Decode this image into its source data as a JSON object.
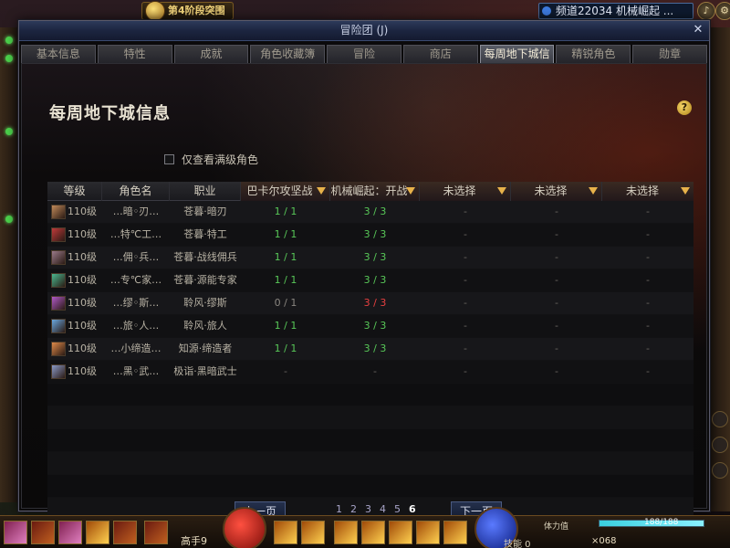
{
  "hud": {
    "stage_badge": "第4阶段突围",
    "channel": "频道22034 机械崛起 ..."
  },
  "window": {
    "title": "冒险团 (J)",
    "close_glyph": "✕",
    "tabs": [
      {
        "label": "基本信息",
        "active": false
      },
      {
        "label": "特性",
        "active": false
      },
      {
        "label": "成就",
        "active": false
      },
      {
        "label": "角色收藏簿",
        "active": false
      },
      {
        "label": "冒险",
        "active": false
      },
      {
        "label": "商店",
        "active": false
      },
      {
        "label": "每周地下城信息",
        "active": true
      },
      {
        "label": "精锐角色",
        "active": false
      },
      {
        "label": "勋章",
        "active": false
      }
    ],
    "heading": "每周地下城信息",
    "help_glyph": "?",
    "only_max_level_label": "仅查看满级角色"
  },
  "table": {
    "headers": {
      "level": "等级",
      "name": "角色名",
      "job": "职业",
      "d1": "巴卡尔攻坚战",
      "d2": "机械崛起：开战",
      "d3": "未选择",
      "d4": "未选择",
      "d5": "未选择"
    },
    "rows": [
      {
        "level": "110级",
        "name": "…暗◦刃…",
        "job": "苍暮·暗刃",
        "d1": "1 / 1",
        "d1_status": "green",
        "d2": "3 / 3",
        "d2_status": "green",
        "d3": "-",
        "d4": "-",
        "d5": "-",
        "avatar_color": "#c08a5a"
      },
      {
        "level": "110级",
        "name": "…特℃工…",
        "job": "苍暮·特工",
        "d1": "1 / 1",
        "d1_status": "green",
        "d2": "3 / 3",
        "d2_status": "green",
        "d3": "-",
        "d4": "-",
        "d5": "-",
        "avatar_color": "#c03a3a"
      },
      {
        "level": "110级",
        "name": "…佣◦兵…",
        "job": "苍暮·战线佣兵",
        "d1": "1 / 1",
        "d1_status": "green",
        "d2": "3 / 3",
        "d2_status": "green",
        "d3": "-",
        "d4": "-",
        "d5": "-",
        "avatar_color": "#9a7a8a"
      },
      {
        "level": "110级",
        "name": "…专℃家…",
        "job": "苍暮·源能专家",
        "d1": "1 / 1",
        "d1_status": "green",
        "d2": "3 / 3",
        "d2_status": "green",
        "d3": "-",
        "d4": "-",
        "d5": "-",
        "avatar_color": "#4ab890"
      },
      {
        "level": "110级",
        "name": "…缪◦斯…",
        "job": "聆风·缪斯",
        "d1": "0 / 1",
        "d1_status": "grey",
        "d2": "3 / 3",
        "d2_status": "red",
        "d3": "-",
        "d4": "-",
        "d5": "-",
        "avatar_color": "#b05ac8"
      },
      {
        "level": "110级",
        "name": "…旅◦人…",
        "job": "聆风·旅人",
        "d1": "1 / 1",
        "d1_status": "green",
        "d2": "3 / 3",
        "d2_status": "green",
        "d3": "-",
        "d4": "-",
        "d5": "-",
        "avatar_color": "#6aa8e0"
      },
      {
        "level": "110级",
        "name": "…小缔造…",
        "job": "知源·缔造者",
        "d1": "1 / 1",
        "d1_status": "green",
        "d2": "3 / 3",
        "d2_status": "green",
        "d3": "-",
        "d4": "-",
        "d5": "-",
        "avatar_color": "#e08a4a"
      },
      {
        "level": "110级",
        "name": "…黑◦武…",
        "job": "极诣·黑暗武士",
        "d1": "-",
        "d1_status": "dash",
        "d2": "-",
        "d2_status": "dash",
        "d3": "-",
        "d4": "-",
        "d5": "-",
        "avatar_color": "#8a9ac8"
      }
    ],
    "empty_rows": 6
  },
  "pager": {
    "prev_label": "上一页",
    "next_label": "下一页",
    "pages": [
      "1",
      "2",
      "3",
      "4",
      "5",
      "6"
    ],
    "current_page": "6"
  },
  "bottom": {
    "hotkey_label": "高手9",
    "fatigue_label": "体力值",
    "fatigue_value": "188/188",
    "fatigue_fraction": 1.0,
    "skill_points_label": "技能 0",
    "coin_label": "×068"
  },
  "colors": {
    "green": "#58c858",
    "red": "#e84040",
    "grey": "#8a8680",
    "accent_tab": "#595c66"
  }
}
